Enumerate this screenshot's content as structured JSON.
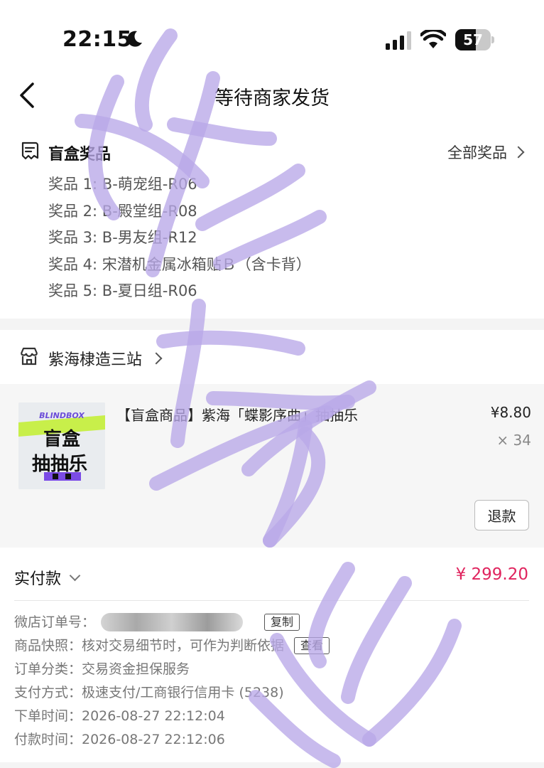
{
  "status_bar": {
    "time": "22:15",
    "battery": "57",
    "battery_level": 0.57
  },
  "nav": {
    "title": "等待商家发货"
  },
  "prizes": {
    "title": "盲盒奖品",
    "all_label": "全部奖品",
    "items": [
      "奖品 1: B-萌宠组-R06",
      "奖品 2: B-殿堂组-R08",
      "奖品 3: B-男友组-R12",
      "奖品 4: 宋潜机金属冰箱贴Ｂ（含卡背）",
      "奖品 5: B-夏日组-R06"
    ]
  },
  "shop": {
    "name": "紫海棣造三站"
  },
  "product": {
    "thumb": {
      "brand": "BLINDBOX",
      "line1": "盲盒",
      "line2": "抽抽乐"
    },
    "title": "【盲盒商品】紫海「蝶影序曲」抽抽乐",
    "price": "¥8.80",
    "qty": "× 34",
    "refund_label": "退款"
  },
  "payment": {
    "label": "实付款",
    "amount": "¥ 299.20",
    "order_label": "微店订单号：",
    "copy_label": "复制",
    "snapshot_label": "商品快照：核对交易细节时，可作为判断依据",
    "view_label": "查看",
    "category": "订单分类：交易资金担保服务",
    "method": "支付方式：极速支付/工商银行信用卡 (5238)",
    "order_time": "下单时间：2026-08-27 22:12:04",
    "pay_time": "付款时间：2026-08-27 22:12:06"
  },
  "colors": {
    "accent": "#e0245e",
    "watermark": "#b9a8e8"
  },
  "icons": [
    "moon-icon",
    "signal-icon",
    "wifi-icon",
    "battery-icon",
    "back-arrow-icon",
    "prize-list-icon",
    "chevron-right-icon",
    "shop-icon",
    "chevron-down-icon"
  ]
}
